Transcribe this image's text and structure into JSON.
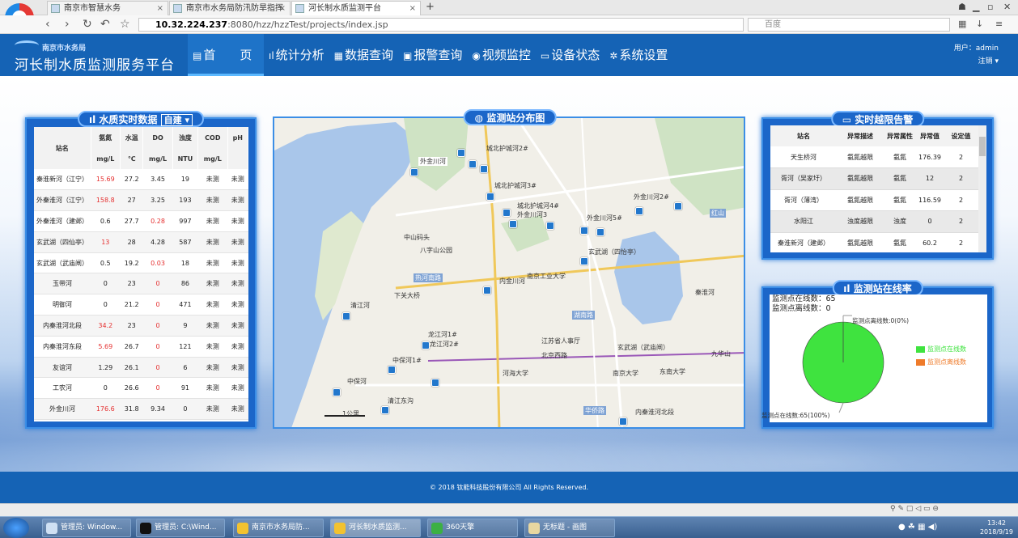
{
  "browser": {
    "tabs": [
      {
        "label": "南京市智慧水务"
      },
      {
        "label": "南京市水务局防汛防旱指挥"
      },
      {
        "label": "河长制水质监测平台"
      }
    ],
    "url_host": "10.32.224.237",
    "url_path": ":8080/hzz/hzzTest/projects/index.jsp",
    "search_placeholder": "百度"
  },
  "header": {
    "org": "南京市水务局",
    "title": "河长制水质监测服务平台",
    "menu": [
      {
        "icon": "▤",
        "label": "首　　页"
      },
      {
        "icon": "ıl",
        "label": "统计分析"
      },
      {
        "icon": "▦",
        "label": "数据查询"
      },
      {
        "icon": "▣",
        "label": "报警查询"
      },
      {
        "icon": "◉",
        "label": "视频监控"
      },
      {
        "icon": "▭",
        "label": "设备状态"
      },
      {
        "icon": "✲",
        "label": "系统设置"
      }
    ],
    "user_label": "用户：admin",
    "logout_label": "注销 ▾"
  },
  "water_quality": {
    "title": "水质实时数据",
    "selector": "自建",
    "headers": [
      "站名",
      "氨氮",
      "水温",
      "DO",
      "浊度",
      "COD",
      "pH"
    ],
    "units": [
      "mg/L",
      "℃",
      "mg/L",
      "NTU",
      "mg/L"
    ],
    "rows": [
      {
        "name": "秦淮新河（江宁）",
        "nh": "15.69",
        "temp": "27.2",
        "do": "3.45",
        "turb": "19",
        "cod": "未测",
        "ph": "未测",
        "nh_red": true,
        "do_red": false
      },
      {
        "name": "外秦淮河（江宁）",
        "nh": "158.8",
        "temp": "27",
        "do": "3.25",
        "turb": "193",
        "cod": "未测",
        "ph": "未测",
        "nh_red": true,
        "do_red": false
      },
      {
        "name": "外秦淮河（建邺）",
        "nh": "0.6",
        "temp": "27.7",
        "do": "0.28",
        "turb": "997",
        "cod": "未测",
        "ph": "未测",
        "nh_red": false,
        "do_red": true
      },
      {
        "name": "玄武湖（四仙亭）",
        "nh": "13",
        "temp": "28",
        "do": "4.28",
        "turb": "587",
        "cod": "未测",
        "ph": "未测",
        "nh_red": true,
        "do_red": false
      },
      {
        "name": "玄武湖（武庙闸）",
        "nh": "0.5",
        "temp": "19.2",
        "do": "0.03",
        "turb": "18",
        "cod": "未测",
        "ph": "未测",
        "nh_red": false,
        "do_red": true
      },
      {
        "name": "玉带河",
        "nh": "0",
        "temp": "23",
        "do": "0",
        "turb": "86",
        "cod": "未测",
        "ph": "未测",
        "nh_red": false,
        "do_red": true
      },
      {
        "name": "明御河",
        "nh": "0",
        "temp": "21.2",
        "do": "0",
        "turb": "471",
        "cod": "未测",
        "ph": "未测",
        "nh_red": false,
        "do_red": true
      },
      {
        "name": "内秦淮河北段",
        "nh": "34.2",
        "temp": "23",
        "do": "0",
        "turb": "9",
        "cod": "未测",
        "ph": "未测",
        "nh_red": true,
        "do_red": true
      },
      {
        "name": "内秦淮河东段",
        "nh": "5.69",
        "temp": "26.7",
        "do": "0",
        "turb": "121",
        "cod": "未测",
        "ph": "未测",
        "nh_red": true,
        "do_red": true
      },
      {
        "name": "友谊河",
        "nh": "1.29",
        "temp": "26.1",
        "do": "0",
        "turb": "6",
        "cod": "未测",
        "ph": "未测",
        "nh_red": false,
        "do_red": true
      },
      {
        "name": "工农河",
        "nh": "0",
        "temp": "26.6",
        "do": "0",
        "turb": "91",
        "cod": "未测",
        "ph": "未测",
        "nh_red": false,
        "do_red": true
      },
      {
        "name": "外金川河",
        "nh": "176.6",
        "temp": "31.8",
        "do": "9.34",
        "turb": "0",
        "cod": "未测",
        "ph": "未测",
        "nh_red": true,
        "do_red": false
      }
    ]
  },
  "map": {
    "title": "监测站分布图",
    "scale": "1公里",
    "labels": [
      "外金川河",
      "城北护城河2#",
      "城北护城河3#",
      "城北护城河4#",
      "外金川河3",
      "外金川河5#",
      "外金川河2#",
      "玄武湖（四怡亭）",
      "内金川河",
      "清江河",
      "龙江河1#",
      "龙江河2#",
      "中保河1#",
      "中保河",
      "玄武湖（武庙闸）",
      "内秦淮河北段",
      "下关大桥",
      "热河南路",
      "中山码头",
      "八字山公园",
      "湖南路",
      "北京西路",
      "江苏省人事厅",
      "河海大学",
      "南京大学",
      "东南大学",
      "华侨路",
      "南京工业大学",
      "红山",
      "九华山",
      "秦淮河",
      "清江东沟"
    ]
  },
  "alarm": {
    "title": "实时越限告警",
    "headers": [
      "站名",
      "异常描述",
      "异常属性",
      "异常值",
      "设定值"
    ],
    "rows": [
      {
        "name": "天生桥河",
        "desc": "氨氮越限",
        "attr": "氨氮",
        "val": "176.39",
        "set": "2"
      },
      {
        "name": "胥河（吴家圩）",
        "desc": "氨氮越限",
        "attr": "氨氮",
        "val": "12",
        "set": "2"
      },
      {
        "name": "胥河（薄湾）",
        "desc": "氨氮越限",
        "attr": "氨氮",
        "val": "116.59",
        "set": "2"
      },
      {
        "name": "水阳江",
        "desc": "浊度越限",
        "attr": "浊度",
        "val": "0",
        "set": "2"
      },
      {
        "name": "秦淮新河（建邺）",
        "desc": "氨氮越限",
        "attr": "氨氮",
        "val": "60.2",
        "set": "2"
      }
    ]
  },
  "online": {
    "title": "监测站在线率",
    "online_text": "监测点在线数：65",
    "offline_text": "监测点离线数：0",
    "offline_label": "监测点离线数:0(0%)",
    "online_label": "监测点在线数:65(100%)",
    "legend_online": "监测点在线数",
    "legend_offline": "监测点离线数",
    "color_online": "#3fe33f",
    "color_offline": "#ef7b2a"
  },
  "chart_data": {
    "type": "pie",
    "categories": [
      "监测点在线数",
      "监测点离线数"
    ],
    "values": [
      65,
      0
    ]
  },
  "footer": {
    "copyright": "© 2018 钛能科技股份有限公司 All Rights Reserved."
  },
  "taskbar": {
    "items": [
      {
        "label": "管理员: Window..."
      },
      {
        "label": "管理员: C:\\Wind..."
      },
      {
        "label": "南京市水务局防..."
      },
      {
        "label": "河长制水质监测..."
      },
      {
        "label": "360天擎"
      },
      {
        "label": "无标题 - 画图"
      }
    ],
    "time": "13:42",
    "date": "2018/9/19"
  }
}
